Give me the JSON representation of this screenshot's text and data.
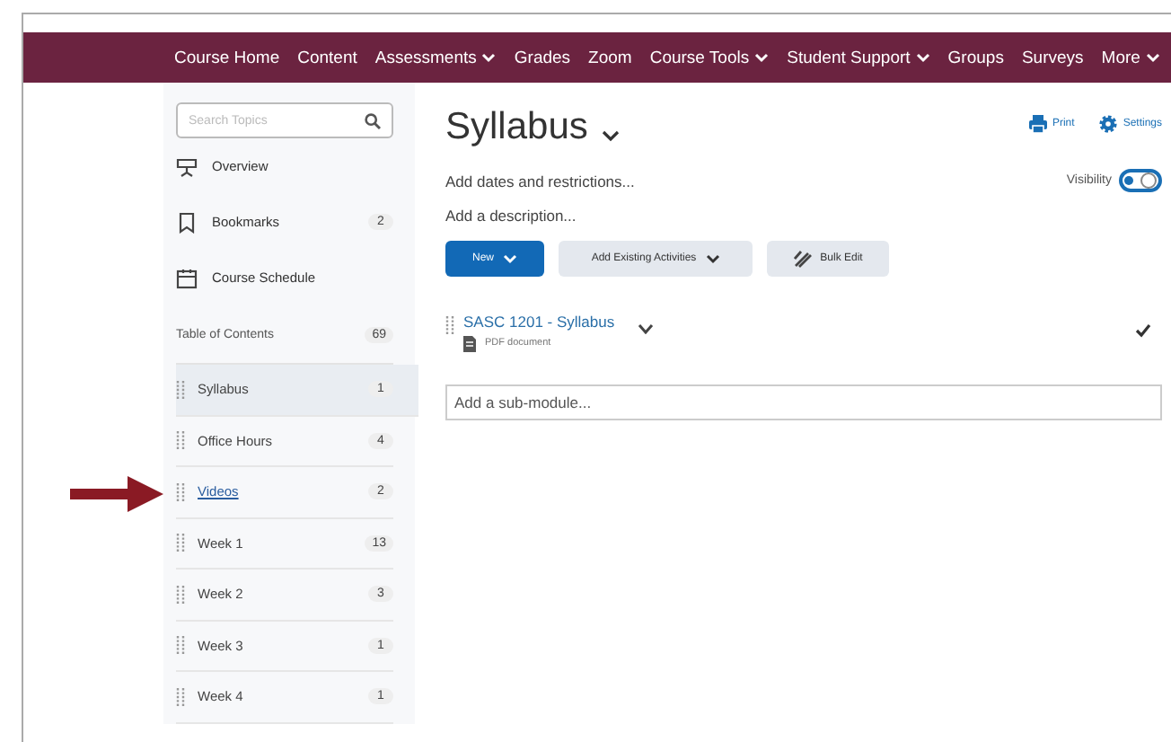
{
  "navbar": {
    "items": [
      {
        "label": "Course Home",
        "has_menu": false
      },
      {
        "label": "Content",
        "has_menu": false
      },
      {
        "label": "Assessments",
        "has_menu": true
      },
      {
        "label": "Grades",
        "has_menu": false
      },
      {
        "label": "Zoom",
        "has_menu": false
      },
      {
        "label": "Course Tools",
        "has_menu": true
      },
      {
        "label": "Student Support",
        "has_menu": true
      },
      {
        "label": "Groups",
        "has_menu": false
      },
      {
        "label": "Surveys",
        "has_menu": false
      },
      {
        "label": "More",
        "has_menu": true
      }
    ]
  },
  "sidebar": {
    "search": {
      "placeholder": "Search Topics"
    },
    "links": [
      {
        "kind": "overview",
        "label": "Overview"
      },
      {
        "kind": "bookmarks",
        "label": "Bookmarks",
        "count": "2"
      },
      {
        "kind": "schedule",
        "label": "Course Schedule"
      }
    ],
    "toc": {
      "label": "Table of Contents",
      "count": "69"
    },
    "modules": [
      {
        "label": "Syllabus",
        "count": "1",
        "selected": true,
        "hovered": false
      },
      {
        "label": "Office Hours",
        "count": "4",
        "selected": false,
        "hovered": false
      },
      {
        "label": "Videos",
        "count": "2",
        "selected": false,
        "hovered": true
      },
      {
        "label": "Week 1",
        "count": "13",
        "selected": false,
        "hovered": false
      },
      {
        "label": "Week 2",
        "count": "3",
        "selected": false,
        "hovered": false
      },
      {
        "label": "Week 3",
        "count": "1",
        "selected": false,
        "hovered": false
      },
      {
        "label": "Week 4",
        "count": "1",
        "selected": false,
        "hovered": false
      }
    ]
  },
  "content": {
    "title": "Syllabus",
    "actions": [
      {
        "kind": "print",
        "label": "Print"
      },
      {
        "kind": "settings",
        "label": "Settings"
      }
    ],
    "dates_link": "Add dates and restrictions...",
    "visibility": {
      "label": "Visibility",
      "on": true
    },
    "description_link": "Add a description...",
    "buttons": [
      {
        "kind": "primary",
        "label": "New"
      },
      {
        "kind": "menu",
        "label": "Add Existing Activities"
      },
      {
        "kind": "bulk",
        "label": "Bulk Edit"
      }
    ],
    "topics": [
      {
        "title": "SASC 1201 - Syllabus",
        "type": "PDF document",
        "completed": true
      }
    ],
    "submodule": {
      "placeholder": "Add a sub-module..."
    }
  },
  "annotation": {
    "arrow_shown": true
  }
}
